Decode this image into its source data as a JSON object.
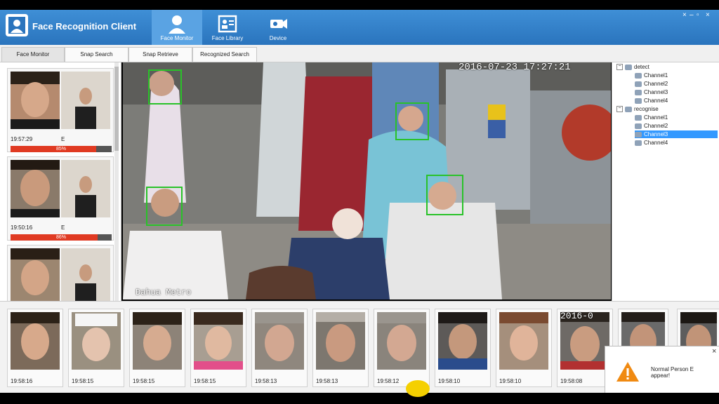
{
  "app": {
    "title": "Face Recognition Client",
    "window_controls": [
      "×",
      "–",
      "▫",
      "×"
    ]
  },
  "modules": [
    {
      "label": "Face Monitor",
      "icon": "person-icon",
      "active": true
    },
    {
      "label": "Face Library",
      "icon": "contact-card-icon",
      "active": false
    },
    {
      "label": "Device",
      "icon": "camera-icon",
      "active": false
    }
  ],
  "tabs": [
    "Face Monitor",
    "Snap Search",
    "Snap Retrieve",
    "Recognized Search"
  ],
  "snaps": [
    {
      "time": "19:57:29",
      "gender": "E",
      "similarity": "85%",
      "similarity_value": 0.85
    },
    {
      "time": "19:50:16",
      "gender": "E",
      "similarity": "86%",
      "similarity_value": 0.86
    },
    {
      "time": "",
      "gender": "",
      "similarity": "",
      "similarity_value": 0
    }
  ],
  "video": {
    "timestamp": "2016-07-23 17:27:21",
    "location": "Dahua Metro"
  },
  "tree": {
    "groups": [
      {
        "label": "detect",
        "expand": "−",
        "channels": [
          "Channel1",
          "Channel2",
          "Channel3",
          "Channel4"
        ]
      },
      {
        "label": "recognise",
        "expand": "−",
        "channels": [
          "Channel1",
          "Channel2",
          "Channel3",
          "Channel4"
        ]
      }
    ],
    "selected": "recognise/Channel3"
  },
  "captures": [
    "19:58:16",
    "19:58:15",
    "19:58:15",
    "19:58:15",
    "19:58:13",
    "19:58:13",
    "19:58:12",
    "19:58:10",
    "19:58:10",
    "19:58:08"
  ],
  "capture_overlay_text": "2016-0",
  "notification": {
    "message": "Normal Person E appear!",
    "close": "×"
  }
}
